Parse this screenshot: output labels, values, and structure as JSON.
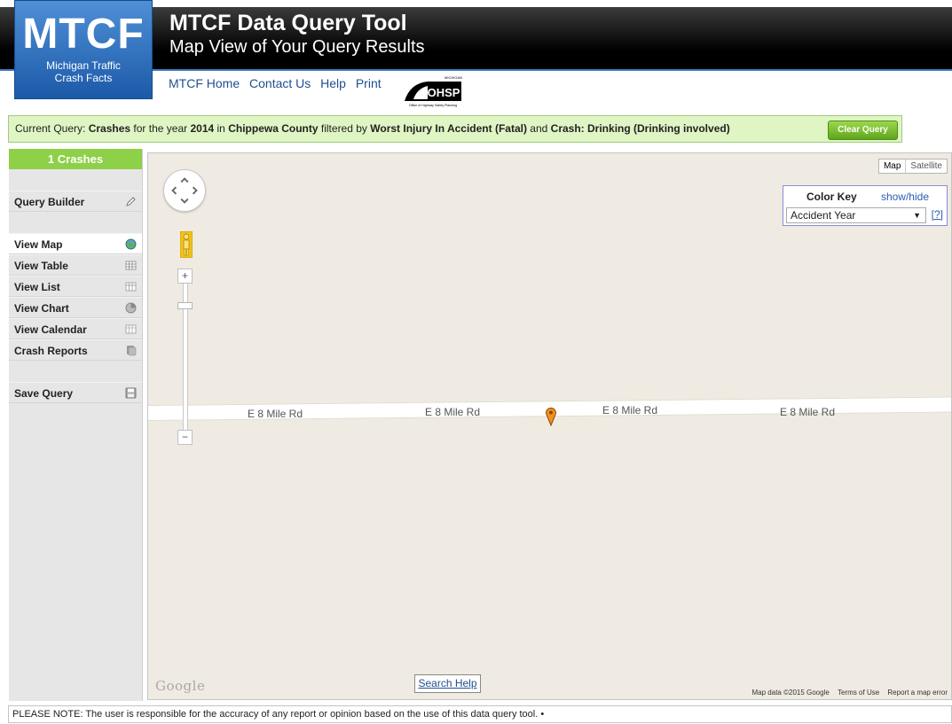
{
  "logo": {
    "main": "MTCF",
    "sub_line1": "Michigan Traffic",
    "sub_line2": "Crash Facts"
  },
  "header": {
    "title": "MTCF Data Query Tool",
    "subtitle": "Map View of Your Query Results"
  },
  "topnav": {
    "home": "MTCF Home",
    "contact": "Contact Us",
    "help": "Help",
    "print": "Print",
    "ohsp_top": "MICHIGAN",
    "ohsp_mark": "OHSP",
    "ohsp_caption": "Office of Highway Safety Planning"
  },
  "query": {
    "prefix": "Current Query:",
    "subject": "Crashes",
    "t1": "for the year",
    "year": "2014",
    "t2": "in",
    "county": "Chippewa County",
    "t3": "filtered by",
    "filter1": "Worst Injury In Accident (Fatal)",
    "t4": "and",
    "filter2": "Crash: Drinking (Drinking involved)",
    "clear_label": "Clear Query"
  },
  "sidebar": {
    "count_label": "1 Crashes",
    "query_builder": "Query Builder",
    "view_map": "View Map",
    "view_table": "View Table",
    "view_list": "View List",
    "view_chart": "View Chart",
    "view_calendar": "View Calendar",
    "crash_reports": "Crash Reports",
    "save_query": "Save Query"
  },
  "map": {
    "type_map": "Map",
    "type_satellite": "Satellite",
    "zoom_in": "+",
    "zoom_out": "−",
    "road_labels": [
      "E 8 Mile Rd",
      "E 8 Mile Rd",
      "E 8 Mile Rd",
      "E 8 Mile Rd"
    ],
    "color_key_title": "Color Key",
    "color_key_toggle": "show/hide",
    "color_key_select": "Accident Year",
    "color_key_help": "[?]",
    "google": "Google",
    "search_help": "Search Help",
    "attribution": {
      "data": "Map data ©2015 Google",
      "terms": "Terms of Use",
      "report": "Report a map error"
    }
  },
  "footer": {
    "note": "PLEASE NOTE: The user is responsible for the accuracy of any report or opinion based on the use of this data query tool. •"
  },
  "colors": {
    "brand_blue": "#1c5aa8",
    "accent_green": "#8ed048",
    "query_bg": "#dff5c4",
    "pin": "#f0921e"
  }
}
